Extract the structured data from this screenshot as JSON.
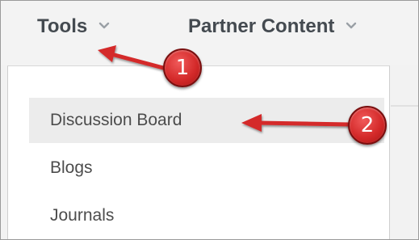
{
  "menubar": {
    "tools_label": "Tools",
    "partner_label": "Partner Content"
  },
  "dropdown": {
    "items": [
      {
        "label": "Discussion Board",
        "active": true
      },
      {
        "label": "Blogs",
        "active": false
      },
      {
        "label": "Journals",
        "active": false
      }
    ]
  },
  "annotations": {
    "badge1": "1",
    "badge2": "2",
    "color": "#d42a2a"
  },
  "colors": {
    "menu_text": "#444a50",
    "item_text": "#4c4c4c",
    "hover_bg": "#ececec"
  }
}
